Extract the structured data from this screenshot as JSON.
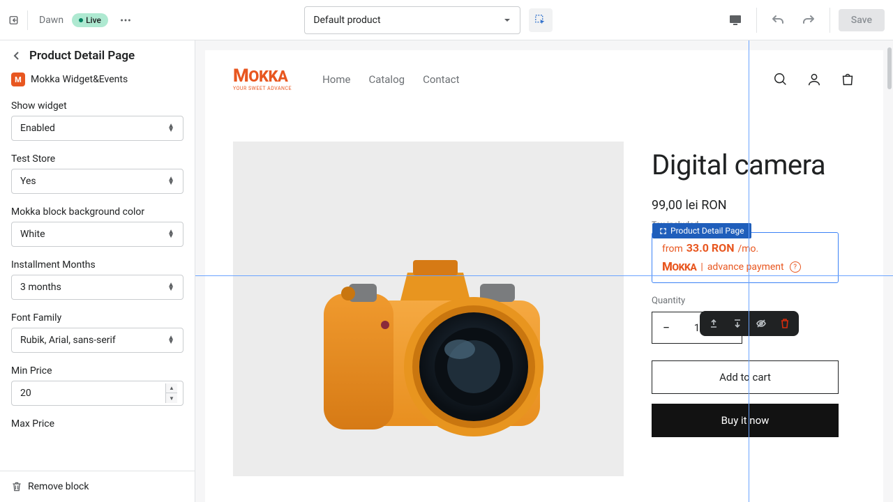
{
  "topbar": {
    "theme_name": "Dawn",
    "live_label": "Live",
    "product_selector": "Default product",
    "save_label": "Save"
  },
  "sidebar": {
    "title": "Product Detail Page",
    "app_name": "Mokka Widget&Events",
    "app_icon_letter": "M",
    "fields": {
      "show_widget": {
        "label": "Show widget",
        "value": "Enabled"
      },
      "test_store": {
        "label": "Test Store",
        "value": "Yes"
      },
      "bg_color": {
        "label": "Mokka block background color",
        "value": "White"
      },
      "months": {
        "label": "Installment Months",
        "value": "3 months"
      },
      "font": {
        "label": "Font Family",
        "value": "Rubik, Arial, sans-serif"
      },
      "min_price": {
        "label": "Min Price",
        "value": "20"
      },
      "max_price": {
        "label": "Max Price"
      }
    },
    "remove_block": "Remove block"
  },
  "store": {
    "logo_main": "MOKKA",
    "logo_sub": "YOUR SWEET ADVANCE",
    "nav": {
      "home": "Home",
      "catalog": "Catalog",
      "contact": "Contact"
    }
  },
  "product": {
    "title": "Digital camera",
    "price": "99,00 lei RON",
    "tax": "Tax included.",
    "quantity_label": "Quantity",
    "quantity_value": "1",
    "add_to_cart": "Add to cart",
    "buy_now": "Buy it now"
  },
  "mokka_widget": {
    "tag": "Product Detail Page",
    "from": "from",
    "amount": "33.0 RON",
    "per": "/mo.",
    "logo": "MOKKA",
    "advance": "advance payment",
    "help": "?"
  }
}
